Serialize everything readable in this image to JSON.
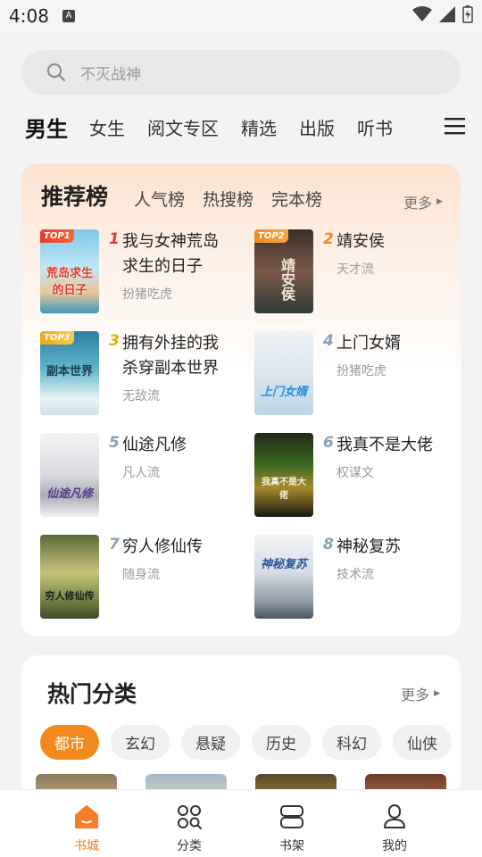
{
  "status_bar": {
    "time": "4:08",
    "a_icon": "A"
  },
  "search": {
    "placeholder": "不灭战神"
  },
  "top_tabs": [
    "男生",
    "女生",
    "阅文专区",
    "精选",
    "出版",
    "听书"
  ],
  "ranking": {
    "title": "推荐榜",
    "tabs": [
      "人气榜",
      "热搜榜",
      "完本榜"
    ],
    "more": "更多",
    "books": [
      {
        "rank": "1",
        "badge": "TOP1",
        "name": "我与女神荒岛求生的日子",
        "tag": "扮猪吃虎",
        "cover_text": "荒岛求生的日子"
      },
      {
        "rank": "2",
        "badge": "TOP2",
        "name": "靖安侯",
        "tag": "天才流",
        "cover_text": "靖安侯"
      },
      {
        "rank": "3",
        "badge": "TOP3",
        "name": "拥有外挂的我杀穿副本世界",
        "tag": "无敌流",
        "cover_text": "副本世界"
      },
      {
        "rank": "4",
        "badge": "",
        "name": "上门女婿",
        "tag": "扮猪吃虎",
        "cover_text": "上门女婿"
      },
      {
        "rank": "5",
        "badge": "",
        "name": "仙途凡修",
        "tag": "凡人流",
        "cover_text": "仙途凡修"
      },
      {
        "rank": "6",
        "badge": "",
        "name": "我真不是大佬",
        "tag": "权谋文",
        "cover_text": "我真不是大佬"
      },
      {
        "rank": "7",
        "badge": "",
        "name": "穷人修仙传",
        "tag": "随身流",
        "cover_text": "穷人修仙传"
      },
      {
        "rank": "8",
        "badge": "",
        "name": "神秘复苏",
        "tag": "技术流",
        "cover_text": "神秘复苏"
      }
    ]
  },
  "hot_categories": {
    "title": "热门分类",
    "more": "更多",
    "chips": [
      "都市",
      "玄幻",
      "悬疑",
      "历史",
      "科幻",
      "仙侠"
    ]
  },
  "bottom_nav": [
    {
      "label": "书城",
      "icon": "home-icon",
      "active": true
    },
    {
      "label": "分类",
      "icon": "category-grid-icon",
      "active": false
    },
    {
      "label": "书架",
      "icon": "bookshelf-icon",
      "active": false
    },
    {
      "label": "我的",
      "icon": "profile-icon",
      "active": false
    }
  ],
  "colors": {
    "accent": "#f07c1e",
    "rank_top1": "#e23b2e",
    "rank_top2": "#f08a24",
    "rank_top3": "#eba91a",
    "rank_rest": "#8aa0b6"
  }
}
